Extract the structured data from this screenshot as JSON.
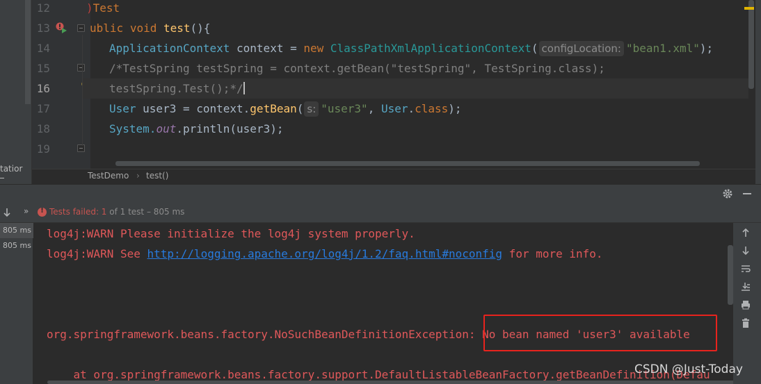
{
  "editor": {
    "line_numbers": [
      "12",
      "13",
      "14",
      "15",
      "16",
      "17",
      "18",
      "19"
    ],
    "line12": {
      "partial": "Test"
    },
    "line13": {
      "kw_partial": "ublic",
      "kw_void": "void",
      "method": "test",
      "rest": "(){"
    },
    "line14": {
      "type": "ApplicationContext",
      "var": " context = ",
      "kw_new": "new",
      "cls": "ClassPathXmlApplicationContext",
      "paren": "(",
      "hint": "configLocation:",
      "str": "\"bean1.xml\"",
      "end": ");"
    },
    "line15": {
      "comment": "/*TestSpring testSpring = context.getBean(\"testSpring\", TestSpring.class);"
    },
    "line16": {
      "comment": "testSpring.Test();*/"
    },
    "line17": {
      "type": "User",
      "var": " user3 = context.",
      "method": "getBean",
      "paren": "(",
      "hint": "s:",
      "str": "\"user3\"",
      "comma": ", ",
      "cls": "User",
      "dot": ".",
      "kw_class": "class",
      "end": ");"
    },
    "line18": {
      "obj": "System.",
      "field": "out",
      "rest": ".println(user3);"
    }
  },
  "left_strip": {
    "fragment": "tatior"
  },
  "breadcrumb": {
    "file": "TestDemo",
    "separator": "›",
    "method": "test()"
  },
  "run": {
    "toolbar_more": "»",
    "status_fail": "Tests failed: 1",
    "status_rest": " of 1 test – 805 ms",
    "tree": [
      "805 ms",
      "805 ms"
    ]
  },
  "console": {
    "line1": "log4j:WARN Please initialize the log4j system properly.",
    "line2_prefix": "log4j:WARN See ",
    "line2_link": "http://logging.apache.org/log4j/1.2/faq.html#noconfig",
    "line2_suffix": " for more info.",
    "line3": "org.springframework.beans.factory.NoSuchBeanDefinitionException: No bean named 'user3' available",
    "line4": "    at org.springframework.beans.factory.support.DefaultListableBeanFactory.getBeanDefinition(Defau"
  },
  "watermark": "CSDN @Just-Today"
}
